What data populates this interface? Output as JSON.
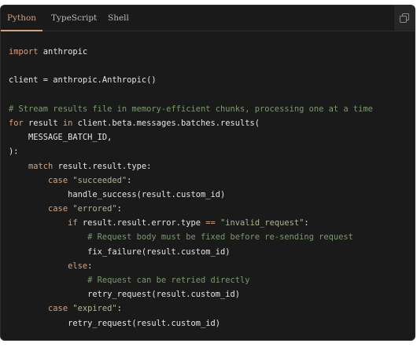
{
  "tabs": [
    {
      "label": "Python",
      "active": true
    },
    {
      "label": "TypeScript",
      "active": false
    },
    {
      "label": "Shell",
      "active": false
    }
  ],
  "copy_button": {
    "icon": "copy-icon"
  },
  "colors": {
    "accent": "#d4a27f",
    "background": "#1a1a1a",
    "text": "#e5e5e5",
    "string": "#a8b98b",
    "comment": "#7a9a6c"
  },
  "code_lines": [
    [
      {
        "t": "kw",
        "v": "import"
      },
      {
        "t": "p",
        "v": " anthropic"
      }
    ],
    [],
    [
      {
        "t": "p",
        "v": "client = anthropic.Anthropic()"
      }
    ],
    [],
    [
      {
        "t": "cm",
        "v": "# Stream results file in memory-efficient chunks, processing one at a time"
      }
    ],
    [
      {
        "t": "kw",
        "v": "for"
      },
      {
        "t": "p",
        "v": " result "
      },
      {
        "t": "kw",
        "v": "in"
      },
      {
        "t": "p",
        "v": " client.beta.messages.batches.results("
      }
    ],
    [
      {
        "t": "p",
        "v": "    MESSAGE_BATCH_ID,"
      }
    ],
    [
      {
        "t": "p",
        "v": "):"
      }
    ],
    [
      {
        "t": "p",
        "v": "    "
      },
      {
        "t": "kw",
        "v": "match"
      },
      {
        "t": "p",
        "v": " result.result.type:"
      }
    ],
    [
      {
        "t": "p",
        "v": "        "
      },
      {
        "t": "kw",
        "v": "case"
      },
      {
        "t": "p",
        "v": " "
      },
      {
        "t": "str",
        "v": "\"succeeded\""
      },
      {
        "t": "p",
        "v": ":"
      }
    ],
    [
      {
        "t": "p",
        "v": "            handle_success(result.custom_id)"
      }
    ],
    [
      {
        "t": "p",
        "v": "        "
      },
      {
        "t": "kw",
        "v": "case"
      },
      {
        "t": "p",
        "v": " "
      },
      {
        "t": "str",
        "v": "\"errored\""
      },
      {
        "t": "p",
        "v": ":"
      }
    ],
    [
      {
        "t": "p",
        "v": "            "
      },
      {
        "t": "kw",
        "v": "if"
      },
      {
        "t": "p",
        "v": " result.result.error.type "
      },
      {
        "t": "op",
        "v": "=="
      },
      {
        "t": "p",
        "v": " "
      },
      {
        "t": "str",
        "v": "\"invalid_request\""
      },
      {
        "t": "p",
        "v": ":"
      }
    ],
    [
      {
        "t": "p",
        "v": "                "
      },
      {
        "t": "cm",
        "v": "# Request body must be fixed before re-sending request"
      }
    ],
    [
      {
        "t": "p",
        "v": "                fix_failure(result.custom_id)"
      }
    ],
    [
      {
        "t": "p",
        "v": "            "
      },
      {
        "t": "kw",
        "v": "else"
      },
      {
        "t": "p",
        "v": ":"
      }
    ],
    [
      {
        "t": "p",
        "v": "                "
      },
      {
        "t": "cm",
        "v": "# Request can be retried directly"
      }
    ],
    [
      {
        "t": "p",
        "v": "                retry_request(result.custom_id)"
      }
    ],
    [
      {
        "t": "p",
        "v": "        "
      },
      {
        "t": "kw",
        "v": "case"
      },
      {
        "t": "p",
        "v": " "
      },
      {
        "t": "str",
        "v": "\"expired\""
      },
      {
        "t": "p",
        "v": ":"
      }
    ],
    [
      {
        "t": "p",
        "v": "            retry_request(result.custom_id)"
      }
    ]
  ]
}
